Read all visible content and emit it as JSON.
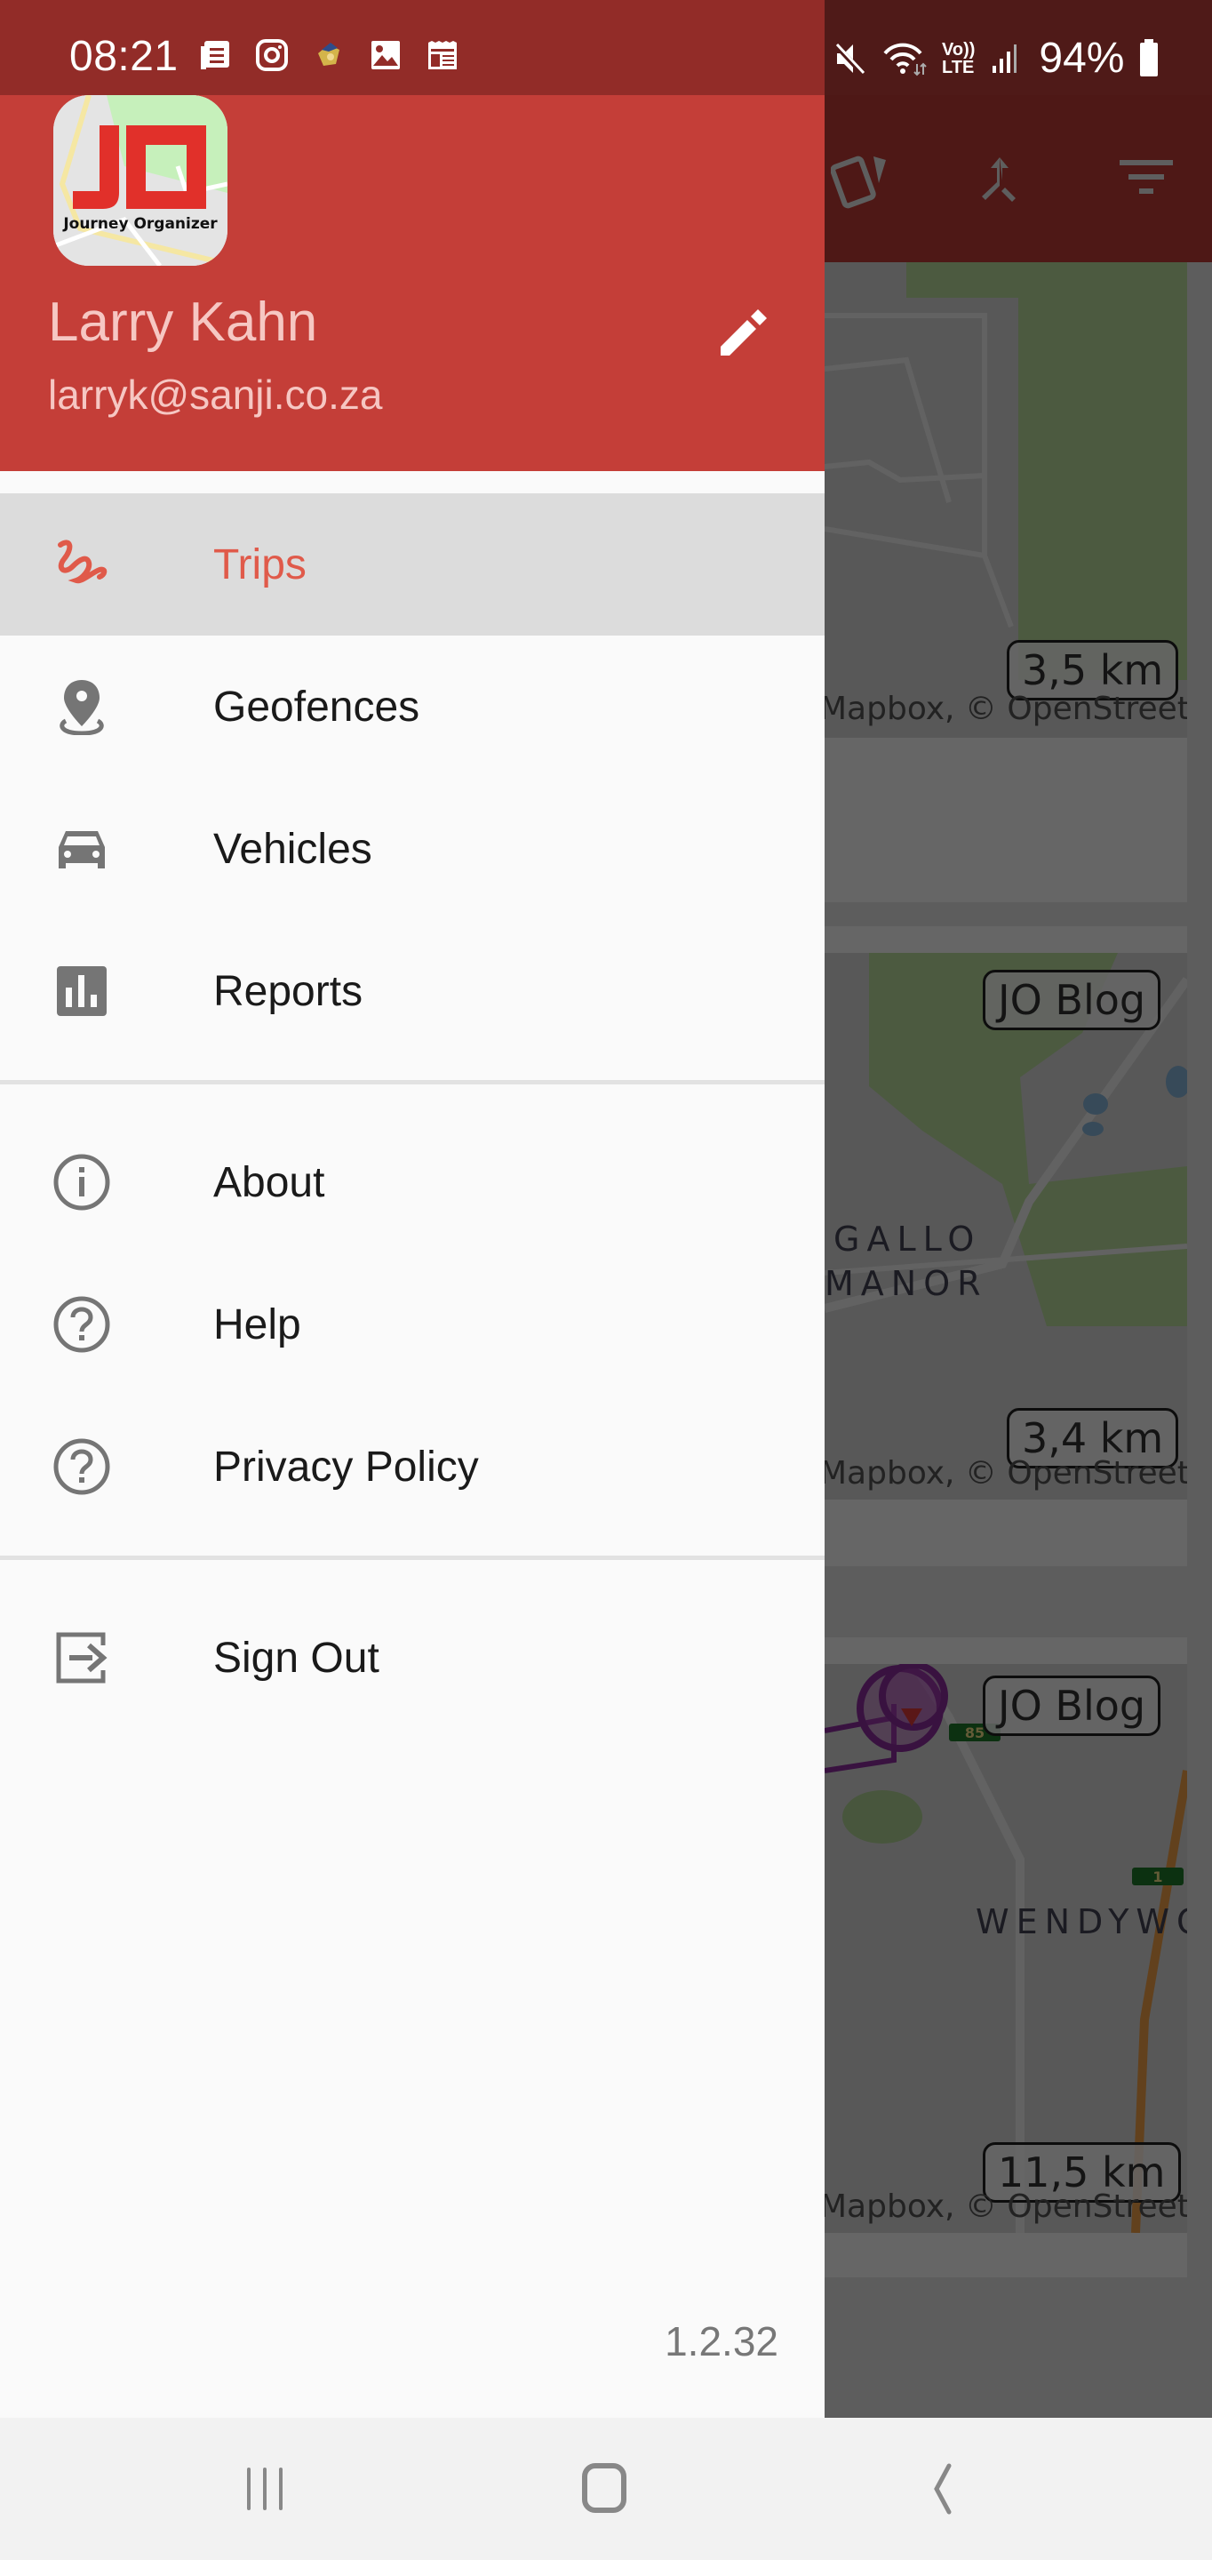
{
  "status_bar": {
    "time": "08:21",
    "left_icons": [
      "news-icon",
      "instagram-icon",
      "game-app-icon",
      "gallery-icon",
      "calendar-news-icon"
    ],
    "right_icons": [
      "mute-icon",
      "wifi-icon",
      "volte-icon",
      "signal-icon"
    ],
    "volte_top": "Vo))",
    "volte_bottom": "LTE",
    "battery_percent": "94%"
  },
  "drawer": {
    "logo": {
      "letters": "JO",
      "caption": "Journey Organizer"
    },
    "user": {
      "name": "Larry Kahn",
      "email": "larryk@sanji.co.za"
    },
    "menu_groups": [
      [
        {
          "id": "trips",
          "label": "Trips",
          "icon": "trips-icon",
          "selected": true
        },
        {
          "id": "geofences",
          "label": "Geofences",
          "icon": "geofence-pin-icon",
          "selected": false
        },
        {
          "id": "vehicles",
          "label": "Vehicles",
          "icon": "car-icon",
          "selected": false
        },
        {
          "id": "reports",
          "label": "Reports",
          "icon": "bar-chart-icon",
          "selected": false
        }
      ],
      [
        {
          "id": "about",
          "label": "About",
          "icon": "info-icon",
          "selected": false
        },
        {
          "id": "help",
          "label": "Help",
          "icon": "help-icon",
          "selected": false
        },
        {
          "id": "privacy",
          "label": "Privacy Policy",
          "icon": "help-icon",
          "selected": false
        }
      ],
      [
        {
          "id": "signout",
          "label": "Sign Out",
          "icon": "sign-out-icon",
          "selected": false
        }
      ]
    ],
    "version": "1.2.32"
  },
  "background_app": {
    "toolbar_icons": [
      "cards-icon",
      "merge-icon",
      "filter-icon"
    ],
    "trips": [
      {
        "distance": "3,5 km",
        "tag": "",
        "attribution": "Mapbox, © OpenStreetMap"
      },
      {
        "distance": "3,4 km",
        "tag": "JO Blog",
        "place": [
          "GALLO",
          "MANOR"
        ],
        "attribution": "Mapbox, © OpenStreetMap"
      },
      {
        "distance": "11,5 km",
        "tag": "JO Blog",
        "place": [
          "WENDYWOOD"
        ],
        "route_badges": [
          "85",
          "1"
        ],
        "attribution": "Mapbox, © OpenStreetMap"
      }
    ]
  },
  "nav_bar": {
    "buttons": [
      "recents-icon",
      "home-icon",
      "back-icon"
    ]
  },
  "colors": {
    "primary": "#c43e38",
    "status_bar": "#922c28",
    "selected_text": "#e05a4a",
    "icon_gray": "#757575"
  }
}
